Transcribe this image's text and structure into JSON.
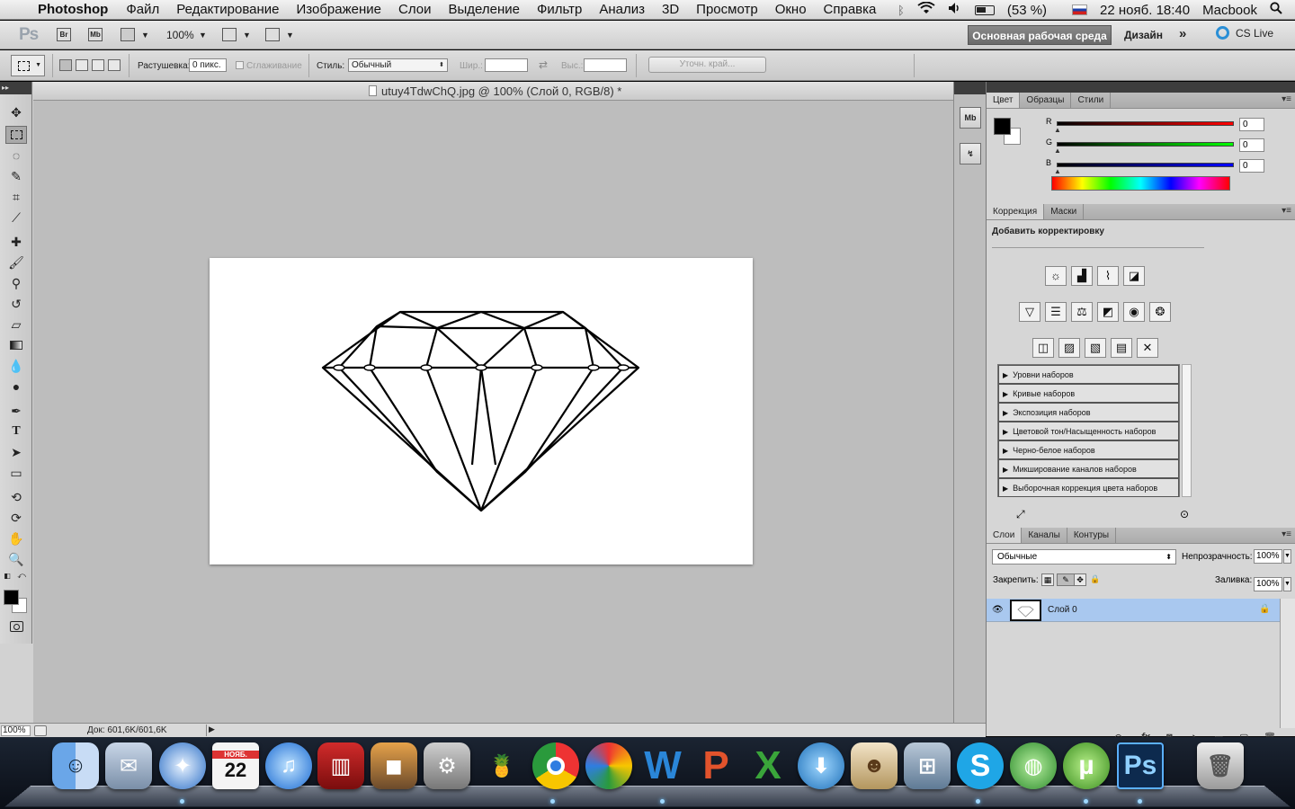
{
  "menubar": {
    "app": "Photoshop",
    "items": [
      "Файл",
      "Редактирование",
      "Изображение",
      "Слои",
      "Выделение",
      "Фильтр",
      "Анализ",
      "3D",
      "Просмотр",
      "Окно",
      "Справка"
    ],
    "battery": "(53 %)",
    "datetime": "22 нояб. 18:40",
    "user": "Macbook"
  },
  "appbar": {
    "logo": "Ps",
    "br": "Br",
    "mb": "Mb",
    "zoom": "100%",
    "workspace_active": "Основная рабочая среда",
    "workspace_design": "Дизайн",
    "more": "»",
    "cslive": "CS Live"
  },
  "options": {
    "feather_label": "Растушевка:",
    "feather_value": "0 пикс.",
    "antialias_label": "Сглаживание",
    "style_label": "Стиль:",
    "style_value": "Обычный",
    "width_label": "Шир.:",
    "height_label": "Выс.:",
    "refine_edge": "Уточн. край..."
  },
  "document": {
    "tab_title": "utuy4TdwChQ.jpg @ 100% (Слой 0, RGB/8) *",
    "status_zoom": "100%",
    "status_doc": "Док: 601,6K/601,6K"
  },
  "color_panel": {
    "tabs": [
      "Цвет",
      "Образцы",
      "Стили"
    ],
    "channels": [
      {
        "name": "R",
        "value": "0",
        "color": "#ff0000"
      },
      {
        "name": "G",
        "value": "0",
        "color": "#00ff00"
      },
      {
        "name": "B",
        "value": "0",
        "color": "#0000ff"
      }
    ]
  },
  "adjustments_panel": {
    "tabs": [
      "Коррекция",
      "Маски"
    ],
    "title": "Добавить корректировку",
    "presets": [
      "Уровни наборов",
      "Кривые наборов",
      "Экспозиция наборов",
      "Цветовой тон/Насыщенность наборов",
      "Черно-белое наборов",
      "Микширование каналов наборов",
      "Выборочная коррекция цвета наборов"
    ]
  },
  "layers_panel": {
    "tabs": [
      "Слои",
      "Каналы",
      "Контуры"
    ],
    "blend_mode": "Обычные",
    "opacity_label": "Непрозрачность:",
    "opacity_value": "100%",
    "lock_label": "Закрепить:",
    "fill_label": "Заливка:",
    "fill_value": "100%",
    "layer_name": "Слой 0"
  },
  "dock": {
    "calendar_month": "НОЯБ.",
    "calendar_day": "22"
  }
}
